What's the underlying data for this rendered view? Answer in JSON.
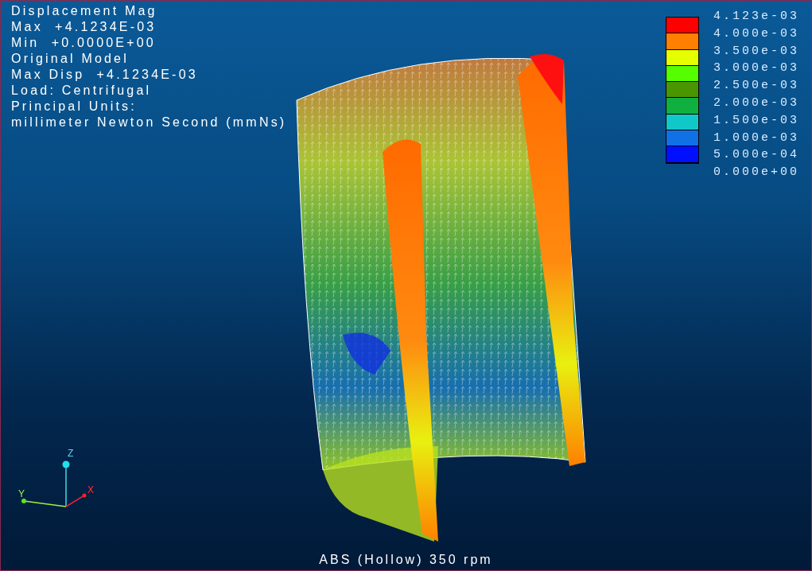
{
  "info_lines": [
    "Displacement Mag",
    "Max  +4.1234E-03",
    "Min  +0.0000E+00",
    "Original Model",
    "Max Disp  +4.1234E-03",
    "Load: Centrifugal",
    "Principal Units:",
    "millimeter Newton Second (mmNs)"
  ],
  "legend": [
    {
      "label": "4.123e-03",
      "color": "#ff0000"
    },
    {
      "label": "4.000e-03",
      "color": "#ff8000"
    },
    {
      "label": "3.500e-03",
      "color": "#e6ff00"
    },
    {
      "label": "3.000e-03",
      "color": "#55ff00"
    },
    {
      "label": "2.500e-03",
      "color": "#4a9600"
    },
    {
      "label": "2.000e-03",
      "color": "#10b040"
    },
    {
      "label": "1.500e-03",
      "color": "#10c8c8"
    },
    {
      "label": "1.000e-03",
      "color": "#1070e6"
    },
    {
      "label": "5.000e-04",
      "color": "#0010ff"
    },
    {
      "label": "0.000e+00"
    }
  ],
  "axes": {
    "z": "Z",
    "y": "Y",
    "x": "X"
  },
  "caption": "ABS (Hollow) 350 rpm"
}
